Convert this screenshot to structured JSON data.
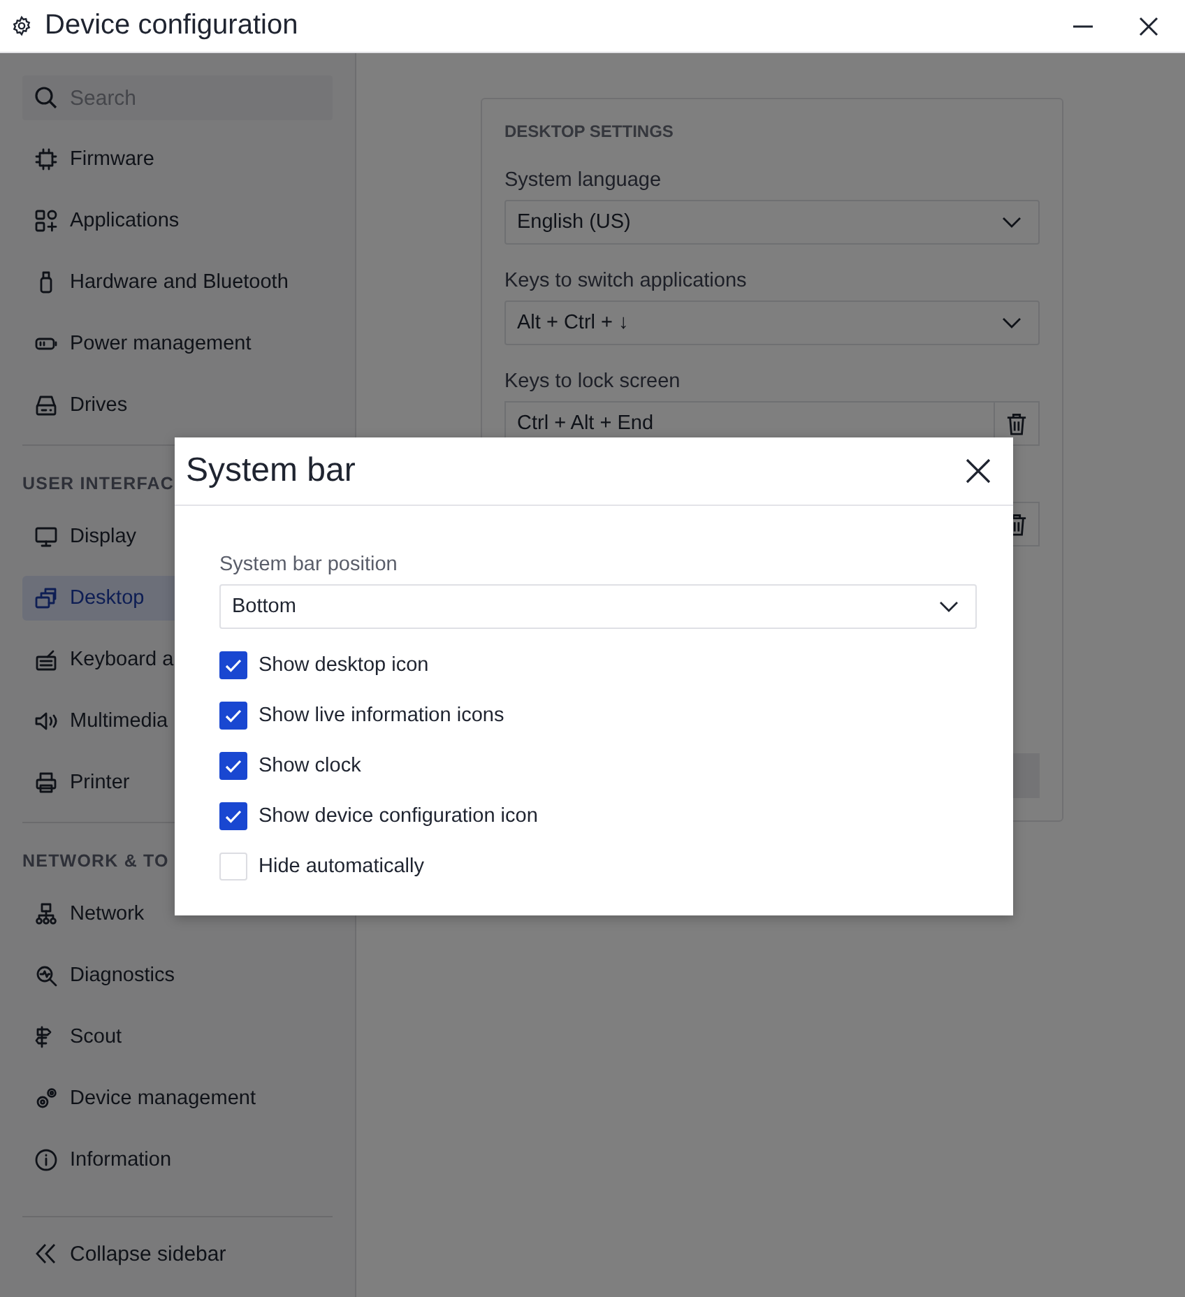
{
  "window": {
    "title": "Device configuration"
  },
  "sidebar": {
    "search": {
      "placeholder": "Search"
    },
    "sections": [
      {
        "items": [
          {
            "label": "Firmware",
            "selected": false
          },
          {
            "label": "Applications",
            "selected": false
          },
          {
            "label": "Hardware and Bluetooth",
            "selected": false
          },
          {
            "label": "Power management",
            "selected": false
          },
          {
            "label": "Drives",
            "selected": false
          }
        ]
      },
      {
        "heading": "USER INTERFAC",
        "items": [
          {
            "label": "Display",
            "selected": false
          },
          {
            "label": "Desktop",
            "selected": true
          },
          {
            "label": "Keyboard a",
            "selected": false
          },
          {
            "label": "Multimedia",
            "selected": false
          },
          {
            "label": "Printer",
            "selected": false
          }
        ]
      },
      {
        "heading": "NETWORK & TO",
        "items": [
          {
            "label": "Network",
            "selected": false
          },
          {
            "label": "Diagnostics",
            "selected": false
          },
          {
            "label": "Scout",
            "selected": false
          },
          {
            "label": "Device management",
            "selected": false
          },
          {
            "label": "Information",
            "selected": false
          }
        ]
      }
    ],
    "collapse": "Collapse sidebar"
  },
  "panel": {
    "heading": "DESKTOP SETTINGS",
    "fields": [
      {
        "kind": "select",
        "label": "System language",
        "value": "English (US)"
      },
      {
        "kind": "select",
        "label": "Keys to switch applications",
        "value": "Alt + Ctrl + ↓"
      },
      {
        "kind": "keys",
        "label": "Keys to lock screen",
        "value": "Ctrl + Alt + End"
      },
      {
        "kind": "keys"
      }
    ]
  },
  "dialog": {
    "title": "System bar",
    "position": {
      "label": "System bar position",
      "value": "Bottom"
    },
    "options": [
      {
        "label": "Show desktop icon",
        "checked": true
      },
      {
        "label": "Show live information icons",
        "checked": true
      },
      {
        "label": "Show clock",
        "checked": true
      },
      {
        "label": "Show device configuration icon",
        "checked": true
      },
      {
        "label": "Hide automatically",
        "checked": false
      }
    ]
  }
}
